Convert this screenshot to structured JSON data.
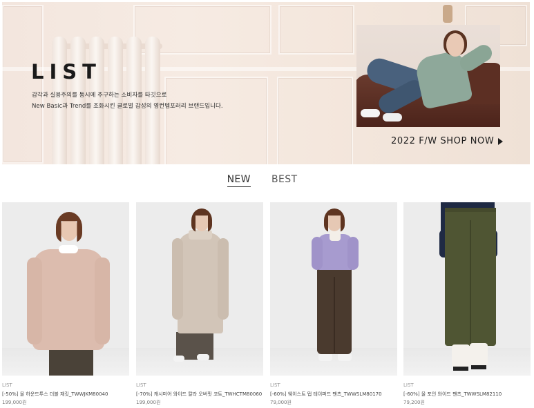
{
  "hero": {
    "logo": "LIST",
    "desc_line1": "감각과 실용주의를 동시에 추구하는 소비자를 타깃으로",
    "desc_line2": "New Basic과 Trend를 조화시킨 글로벌 감성의 영컨템포러리 브랜드입니다.",
    "cta_label": "2022 F/W SHOP NOW"
  },
  "tabs": [
    {
      "label": "NEW",
      "active": true
    },
    {
      "label": "BEST",
      "active": false
    }
  ],
  "products": [
    {
      "brand": "LIST",
      "name": "[-50%] 울 하운드투스 더블 재킷_TWWJKM80040",
      "price": "199,000원"
    },
    {
      "brand": "LIST",
      "name": "[-70%] 캐시미어 와이드 칼라 오버핏 코트_TWHCTM80060",
      "price": "199,000원"
    },
    {
      "brand": "LIST",
      "name": "[-60%] 웨이스트 탭 테이퍼드 팬츠_TWWSLM80170",
      "price": "79,000원"
    },
    {
      "brand": "LIST",
      "name": "[-60%] 울 포인 와이드 팬츠_TWWSLM82110",
      "price": "79,200원"
    }
  ]
}
